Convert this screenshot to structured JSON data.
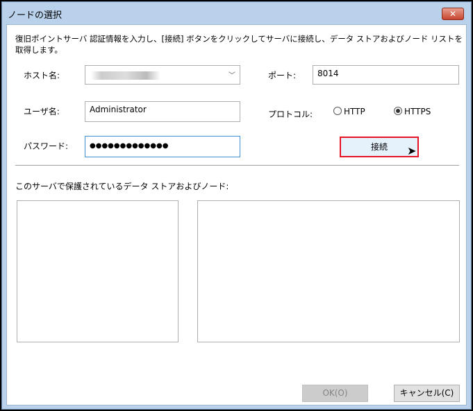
{
  "window": {
    "title": "ノードの選択",
    "close_icon": "close-icon"
  },
  "description": "復旧ポイントサーバ 認証情報を入力し、[接続] ボタンをクリックしてサーバに接続し、データ ストアおよびノード リストを取得します。",
  "form": {
    "host_label": "ホスト名:",
    "port_label": "ポート:",
    "port_value": "8014",
    "user_label": "ユーザ名:",
    "user_value": "Administrator",
    "password_label": "パスワード:",
    "password_value": "●●●●●●●●●●●●●",
    "protocol_label": "プロトコル:",
    "protocol_options": [
      "HTTP",
      "HTTPS"
    ],
    "protocol_selected": "HTTPS",
    "connect_label": "接続"
  },
  "lists_label": "このサーバで保護されているデータ ストアおよびノード:",
  "footer": {
    "ok_label": "OK(O)",
    "cancel_label": "キャンセル(C)"
  },
  "colors": {
    "highlight": "#e81123",
    "focus": "#3c8fd6"
  }
}
